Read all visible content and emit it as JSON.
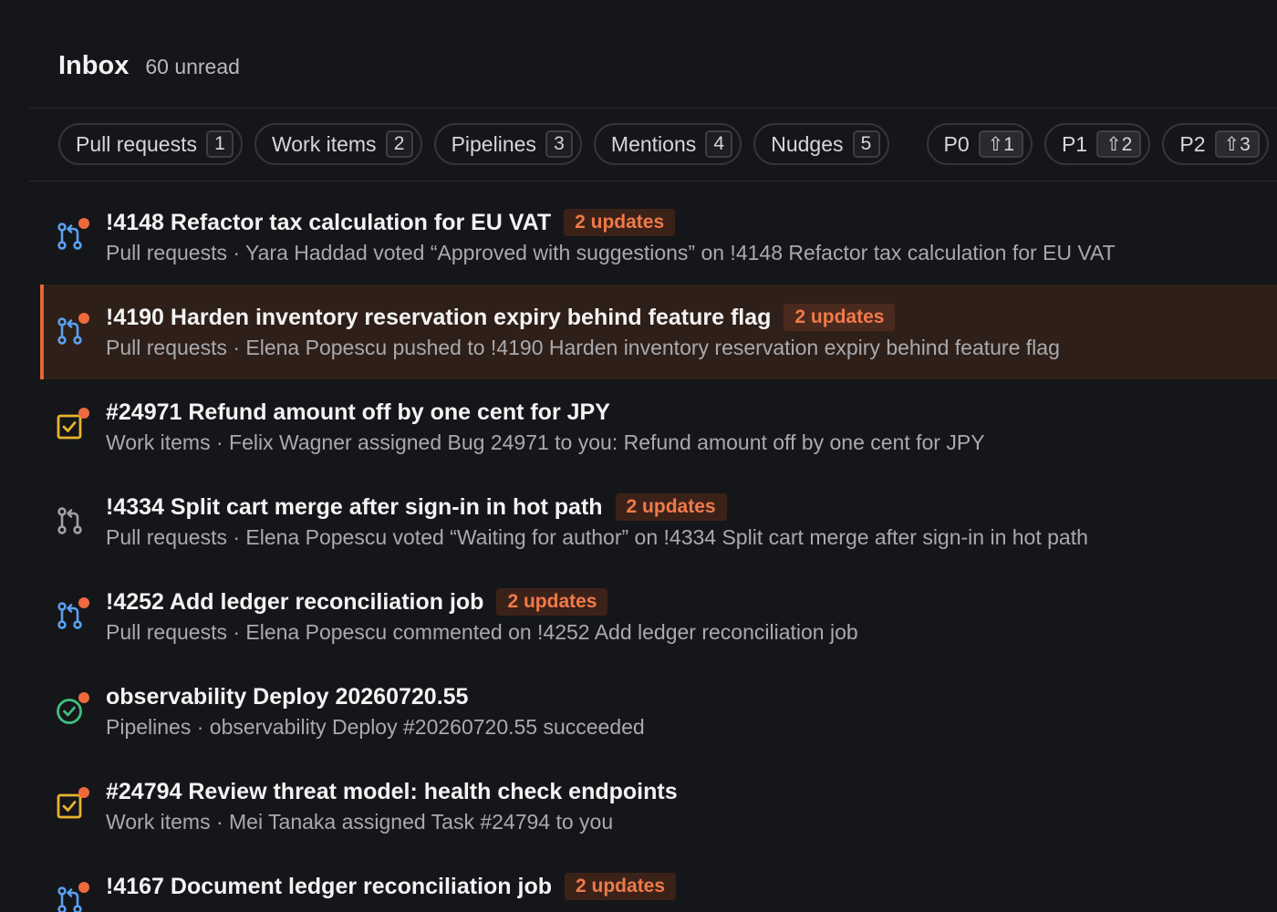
{
  "header": {
    "title": "Inbox",
    "unread": "60 unread"
  },
  "filters": [
    {
      "label": "Pull requests",
      "count": "1"
    },
    {
      "label": "Work items",
      "count": "2"
    },
    {
      "label": "Pipelines",
      "count": "3"
    },
    {
      "label": "Mentions",
      "count": "4"
    },
    {
      "label": "Nudges",
      "count": "5"
    }
  ],
  "priorities": [
    {
      "label": "P0",
      "count": "⇧1"
    },
    {
      "label": "P1",
      "count": "⇧2"
    },
    {
      "label": "P2",
      "count": "⇧3"
    }
  ],
  "items": [
    {
      "icon": "pull-request-icon",
      "iconColor": "#5aa0f0",
      "title": "!4148 Refactor tax calculation for EU VAT",
      "updates": "2 updates",
      "subtitle": "Pull requests · Yara Haddad voted “Approved with suggestions” on !4148 Refactor tax calculation for EU VAT",
      "unread": true
    },
    {
      "icon": "pull-request-icon",
      "iconColor": "#5aa0f0",
      "title": "!4190 Harden inventory reservation expiry behind feature flag",
      "updates": "2 updates",
      "subtitle": "Pull requests · Elena Popescu pushed to !4190 Harden inventory reservation expiry behind feature flag",
      "unread": true,
      "selected": true
    },
    {
      "icon": "task-checkbox-icon",
      "iconColor": "#e8b32e",
      "title": "#24971 Refund amount off by one cent for JPY",
      "updates": "",
      "subtitle": "Work items · Felix Wagner assigned Bug 24971 to you: Refund amount off by one cent for JPY",
      "unread": true
    },
    {
      "icon": "pull-request-icon",
      "iconColor": "#a0a0a6",
      "title": "!4334 Split cart merge after sign-in in hot path",
      "updates": "2 updates",
      "subtitle": "Pull requests · Elena Popescu voted “Waiting for author” on !4334 Split cart merge after sign-in in hot path",
      "unread": false
    },
    {
      "icon": "pull-request-icon",
      "iconColor": "#5aa0f0",
      "title": "!4252 Add ledger reconciliation job",
      "updates": "2 updates",
      "subtitle": "Pull requests · Elena Popescu commented on !4252 Add ledger reconciliation job",
      "unread": true
    },
    {
      "icon": "check-circle-icon",
      "iconColor": "#3fbf7f",
      "title": "observability Deploy 20260720.55",
      "updates": "",
      "subtitle": "Pipelines · observability Deploy #20260720.55 succeeded",
      "unread": true
    },
    {
      "icon": "task-checkbox-icon",
      "iconColor": "#e8b32e",
      "title": "#24794 Review threat model: health check endpoints",
      "updates": "",
      "subtitle": "Work items · Mei Tanaka assigned Task #24794 to you",
      "unread": true
    },
    {
      "icon": "pull-request-icon",
      "iconColor": "#5aa0f0",
      "title": "!4167 Document ledger reconciliation job",
      "updates": "2 updates",
      "subtitle": "",
      "unread": true
    }
  ]
}
